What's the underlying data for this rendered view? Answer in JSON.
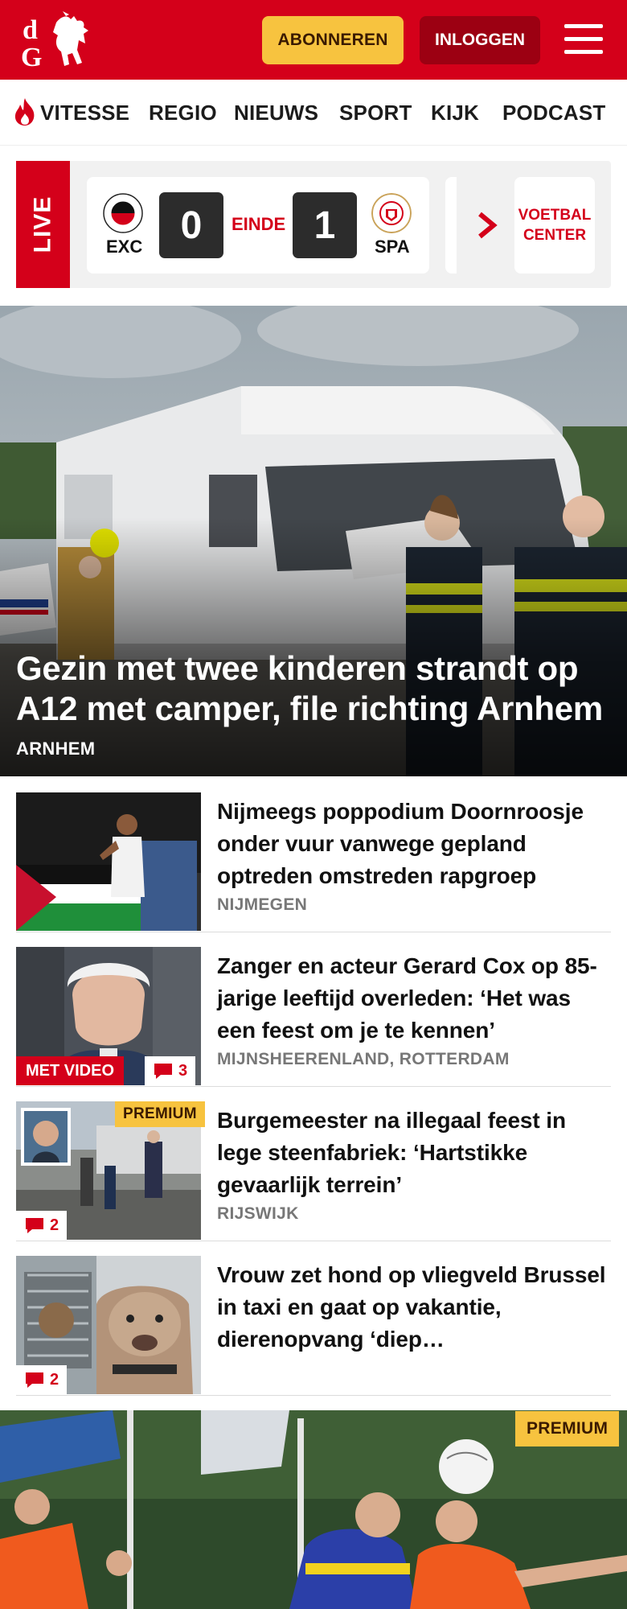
{
  "header": {
    "logo_text": "dG",
    "subscribe_label": "ABONNEREN",
    "login_label": "INLOGGEN",
    "colors": {
      "brand_red": "#d4001a",
      "accent_yellow": "#f7c33f",
      "dark_red": "#9c0012"
    }
  },
  "nav": {
    "items": [
      {
        "label": "VITESSE",
        "icon": "flame-icon"
      },
      {
        "label": "REGIO"
      },
      {
        "label": "NIEUWS"
      },
      {
        "label": "SPORT"
      },
      {
        "label": "KIJK"
      },
      {
        "label": "PODCAST"
      }
    ]
  },
  "live": {
    "label": "LIVE",
    "match": {
      "home_code": "EXC",
      "home_score": "0",
      "status": "EINDE",
      "away_score": "1",
      "away_code": "SPA"
    },
    "voetbal_center": [
      "VOETBAL",
      "CENTER"
    ]
  },
  "hero": {
    "title": "Gezin met twee kinderen strandt op A12 met camper, file richting Arnhem",
    "location": "ARNHEM"
  },
  "articles": [
    {
      "title": "Nijmeegs poppodium Doornroos­je onder vuur vanwege gepland optreden omstreden rapgroep",
      "location": "NIJMEGEN"
    },
    {
      "title": "Zanger en acteur Gerard Cox op 85-jarige leeftijd overleden: ‘Het was een feest om je te kennen’",
      "location": "MIJNSHEERENLAND, ROTTERDAM",
      "video_badge": "MET VIDEO",
      "comments": "3"
    },
    {
      "title": "Burgemeester na illegaal feest in lege steenfabriek: ‘Hartstikke gevaarlijk terrein’",
      "location": "RIJSWIJK",
      "premium_badge": "PREMIUM",
      "comments": "2"
    },
    {
      "title": "Vrouw zet hond op vliegveld Brussel in taxi en gaat op vakantie, dierenopvang ‘diep…",
      "comments": "2"
    }
  ],
  "bottom": {
    "premium_badge": "PREMIUM"
  }
}
